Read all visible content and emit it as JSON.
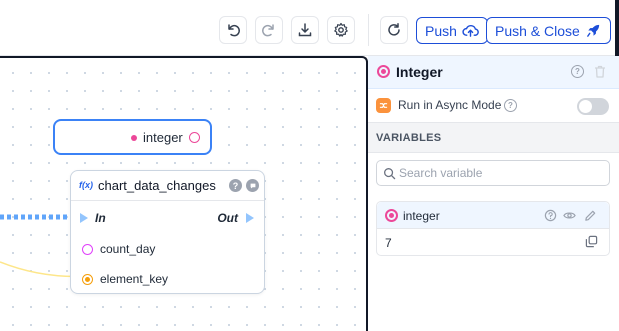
{
  "toolbar": {
    "push_label": "Push",
    "push_close_label": "Push & Close",
    "icons": [
      "undo-icon",
      "redo-icon",
      "download-icon",
      "gear-icon",
      "refresh-icon",
      "cloud-upload-icon",
      "rocket-icon"
    ]
  },
  "canvas": {
    "integer_node": {
      "label": "integer"
    },
    "function_node": {
      "badge": "f(x)",
      "title": "chart_data_changes",
      "in_label": "In",
      "out_label": "Out",
      "params": [
        {
          "label": "count_day",
          "color": "#e040fb"
        },
        {
          "label": "element_key",
          "color": "#f59e0b"
        }
      ]
    }
  },
  "panel": {
    "title": "Integer",
    "async_label": "Run in Async Mode",
    "async_enabled": false,
    "variables_header": "VARIABLES",
    "search_placeholder": "Search variable",
    "variable": {
      "name": "integer",
      "value": "7"
    }
  },
  "colors": {
    "accent": "#1d4ed8",
    "integer": "#ec4899",
    "async": "#fb923c"
  }
}
